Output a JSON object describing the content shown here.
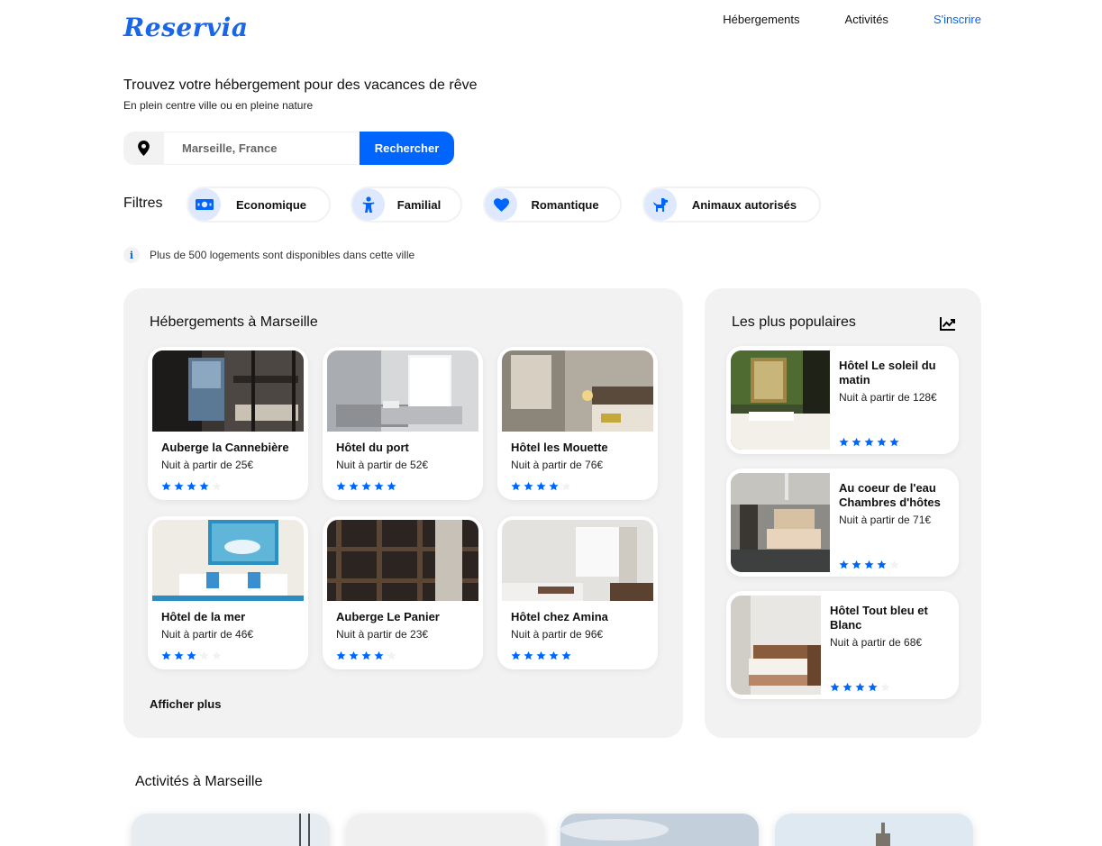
{
  "brand": {
    "logo": "Reservia",
    "accent": "#0065fc"
  },
  "nav": {
    "items": [
      "Hébergements",
      "Activités"
    ],
    "signup": "S'inscrire"
  },
  "hero": {
    "title": "Trouvez votre hébergement pour des vacances de rêve",
    "subtitle": "En plein centre ville ou en pleine nature"
  },
  "search": {
    "icon": "map-pin-icon",
    "placeholder": "Marseille, France",
    "button": "Rechercher"
  },
  "filters": {
    "label": "Filtres",
    "items": [
      {
        "label": "Economique",
        "icon": "money-icon"
      },
      {
        "label": "Familial",
        "icon": "child-icon"
      },
      {
        "label": "Romantique",
        "icon": "heart-icon"
      },
      {
        "label": "Animaux autorisés",
        "icon": "dog-icon"
      }
    ]
  },
  "info": {
    "icon": "info-icon",
    "text": "Plus de 500 logements sont disponibles dans cette ville"
  },
  "lodgings": {
    "title": "Hébergements à Marseille",
    "more": "Afficher plus",
    "items": [
      {
        "name": "Auberge la Cannebière",
        "price": "Nuit à partir de 25€",
        "rating": 4
      },
      {
        "name": "Hôtel du port",
        "price": "Nuit à partir de 52€",
        "rating": 5
      },
      {
        "name": "Hôtel les Mouette",
        "price": "Nuit à partir de 76€",
        "rating": 4
      },
      {
        "name": "Hôtel de la mer",
        "price": "Nuit à partir de 46€",
        "rating": 3
      },
      {
        "name": "Auberge Le Panier",
        "price": "Nuit à partir de 23€",
        "rating": 4
      },
      {
        "name": "Hôtel chez Amina",
        "price": "Nuit à partir de 96€",
        "rating": 5
      }
    ]
  },
  "popular": {
    "title": "Les plus populaires",
    "icon": "trending-chart-icon",
    "items": [
      {
        "name": "Hôtel Le soleil du matin",
        "price": "Nuit à partir de 128€",
        "rating": 5
      },
      {
        "name": "Au coeur de l'eau Chambres d'hôtes",
        "price": "Nuit à partir de 71€",
        "rating": 4
      },
      {
        "name": "Hôtel Tout bleu et Blanc",
        "price": "Nuit à partir de 68€",
        "rating": 4
      }
    ]
  },
  "activities": {
    "title": "Activités à Marseille"
  }
}
